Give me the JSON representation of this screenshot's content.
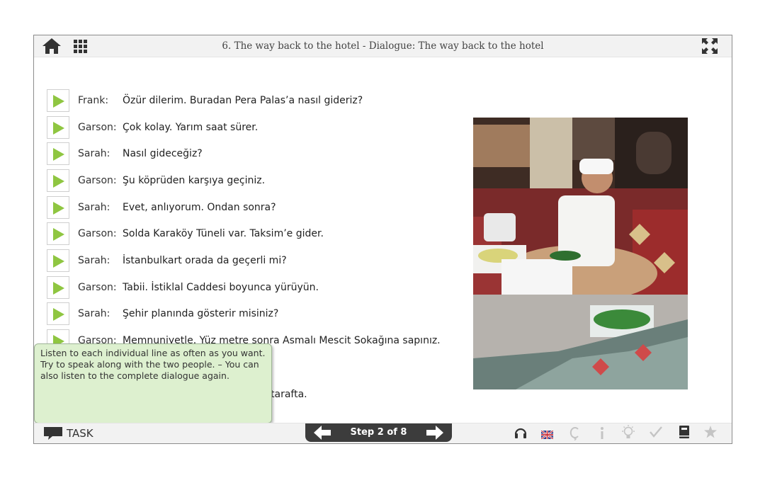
{
  "header": {
    "title": "6. The way back to the hotel - Dialogue: The way back to the hotel",
    "icons": [
      "home-icon",
      "grid-icon",
      "fullscreen-icon"
    ]
  },
  "dialogue": [
    {
      "speaker": "Frank:",
      "text": "Özür dilerim. Buradan Pera Palas’a nasıl gideriz?"
    },
    {
      "speaker": "Garson:",
      "text": "Çok kolay. Yarım saat sürer."
    },
    {
      "speaker": "Sarah:",
      "text": "Nasıl gideceğiz?"
    },
    {
      "speaker": "Garson:",
      "text": "Şu köprüden karşıya geçiniz."
    },
    {
      "speaker": "Sarah:",
      "text": "Evet, anlıyorum. Ondan sonra?"
    },
    {
      "speaker": "Garson:",
      "text": "Solda Karaköy Tüneli var. Taksim’e gider."
    },
    {
      "speaker": "Sarah:",
      "text": "İstanbulkart orada da geçerli mi?"
    },
    {
      "speaker": "Garson:",
      "text": "Tabii. İstiklal Caddesi boyunca yürüyün."
    },
    {
      "speaker": "Sarah:",
      "text": "Şehir planında gösterir misiniz?"
    },
    {
      "speaker": "Garson:",
      "text": "Memnuniyetle. Yüz metre sonra Asmalı Mescit Sokağına sapınız."
    },
    {
      "speaker": "",
      "text": "tarafta."
    }
  ],
  "tooltip": {
    "text": "Listen to each individual line as often as you want. Try to speak along with the two people. – You can also listen to the complete dialogue again."
  },
  "footer": {
    "task_label": "TASK",
    "step_label": "Step 2 of 8",
    "icons": [
      "headphones-icon",
      "uk-flag-icon",
      "c-cedilla-icon",
      "info-icon",
      "lightbulb-icon",
      "check-icon",
      "book-icon",
      "star-icon"
    ]
  },
  "colors": {
    "play_green": "#8fc641",
    "tooltip_bg": "#ddf0cf",
    "stepper_bg": "#3c3c3c"
  }
}
